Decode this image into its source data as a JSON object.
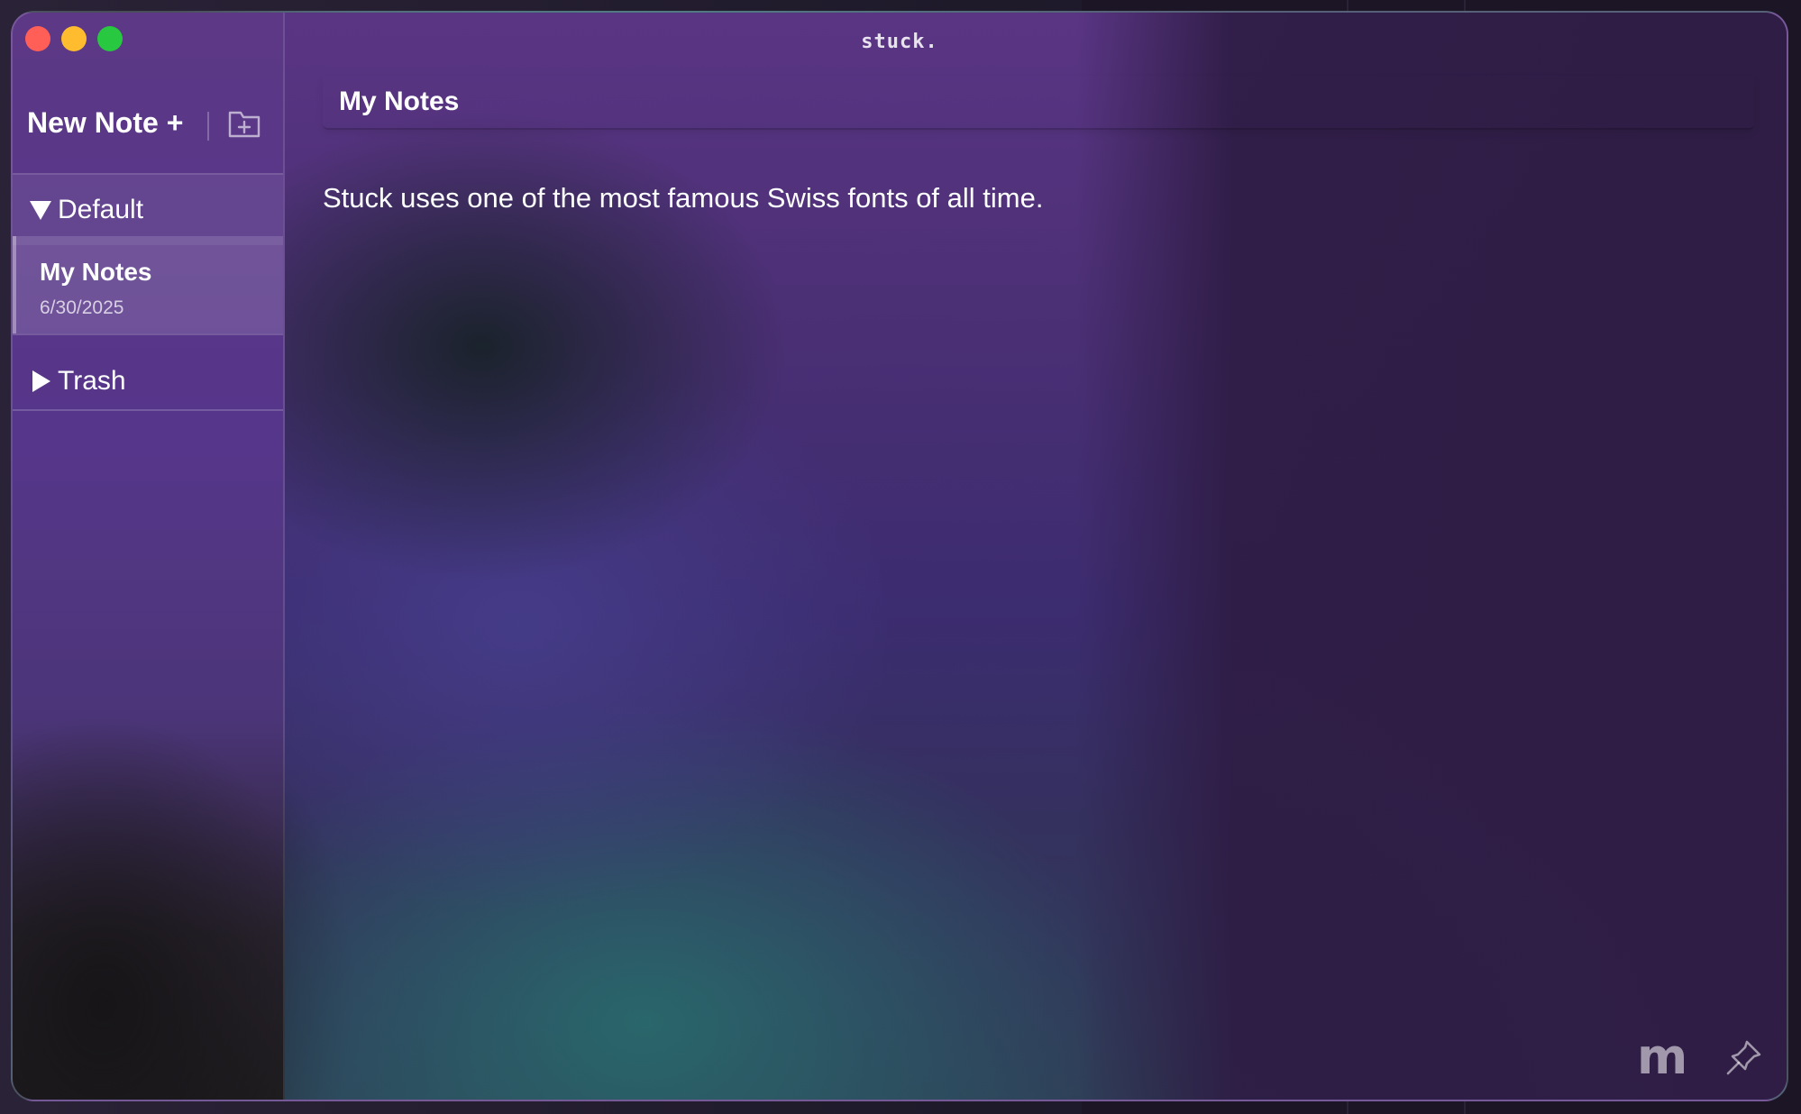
{
  "window": {
    "title": "stuck."
  },
  "sidebar": {
    "new_note_label": "New Note +",
    "folders": [
      {
        "name": "Default",
        "expanded": true,
        "notes": [
          {
            "title": "My Notes",
            "date": "6/30/2025",
            "selected": true
          }
        ]
      },
      {
        "name": "Trash",
        "expanded": false,
        "notes": []
      }
    ]
  },
  "editor": {
    "note_title": "My Notes",
    "body": "Stuck uses one of the most famous Swiss fonts of all time."
  },
  "footer": {
    "m_label": "m"
  },
  "icons": {
    "new_folder": "folder-plus-icon",
    "pin": "pin-icon",
    "expanded": "triangle-down-icon",
    "collapsed": "triangle-right-icon"
  },
  "colors": {
    "close": "#ff5f57",
    "minimize": "#febc2e",
    "maximize": "#28c840",
    "accent": "#5a3584"
  }
}
